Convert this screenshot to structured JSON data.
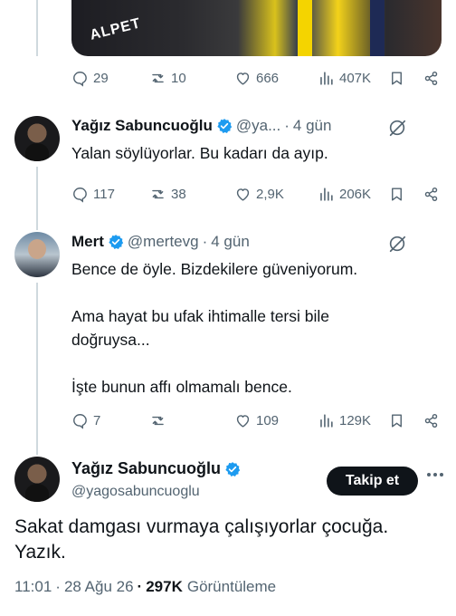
{
  "media": {
    "overlay_text": "ALPET"
  },
  "tweets": [
    {
      "actions": {
        "replies": "29",
        "retweets": "10",
        "likes": "666",
        "views": "407K"
      }
    },
    {
      "name": "Yağız Sabuncuoğlu",
      "handle": "@ya...",
      "separator": "·",
      "time": "4 gün",
      "text": [
        "Yalan söylüyorlar. Bu kadarı da ayıp."
      ],
      "actions": {
        "replies": "117",
        "retweets": "38",
        "likes": "2,9K",
        "views": "206K"
      }
    },
    {
      "name": "Mert",
      "handle": "@mertevg",
      "separator": "·",
      "time": "4 gün",
      "text": [
        "Bence de öyle. Bizdekilere güveniyorum.",
        "Ama hayat bu ufak ihtimalle tersi bile",
        "doğruysa...",
        "İşte bunun affı olmamalı bence."
      ],
      "actions": {
        "replies": "7",
        "retweets": "",
        "likes": "109",
        "views": "129K"
      }
    }
  ],
  "main_tweet": {
    "name": "Yağız Sabuncuoğlu",
    "handle": "@yagosabuncuoglu",
    "follow_label": "Takip et",
    "text_line1": "Sakat damgası vurmaya çalışıyorlar çocuğa.",
    "text_line2": "Yazık.",
    "time": "11:01",
    "date": "28 Ağu 26",
    "meta_sep": "·",
    "views_count": "297K",
    "views_label": "Görüntüleme"
  },
  "colors": {
    "accent": "#1d9bf0",
    "text": "#0f1419",
    "muted": "#536471",
    "line": "#cfd9de"
  },
  "icons": [
    "reply-icon",
    "retweet-icon",
    "like-icon",
    "views-icon",
    "bookmark-icon",
    "share-icon",
    "verified-icon",
    "grok-icon",
    "more-icon"
  ]
}
